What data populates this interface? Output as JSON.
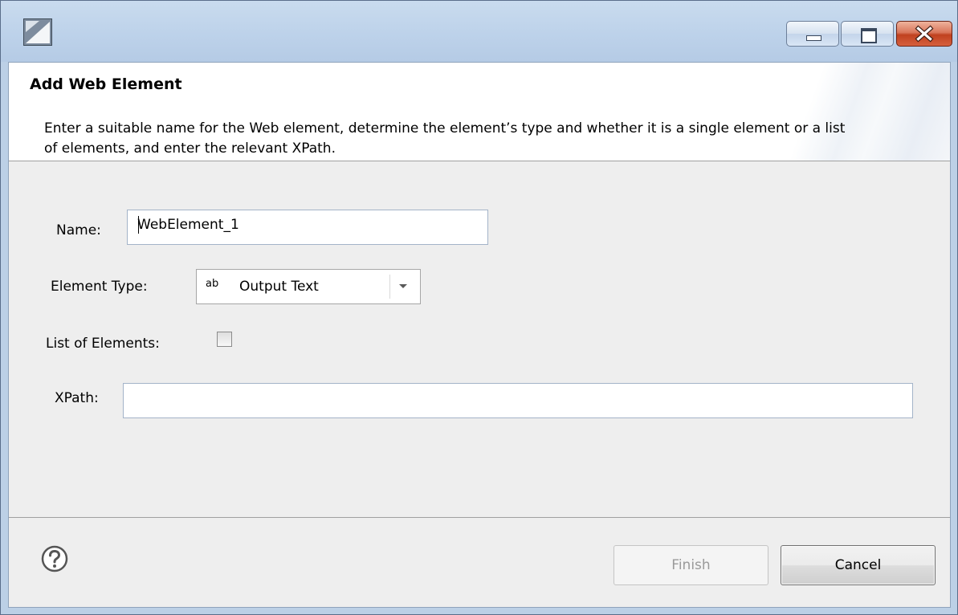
{
  "dialog": {
    "title": "Add Web Element",
    "description": "Enter a suitable name for the Web element, determine the element’s type and whether it is a single element or a list of elements, and enter the relevant XPath."
  },
  "form": {
    "name_label": "Name:",
    "name_value": "WebElement_1",
    "element_type_label": "Element Type:",
    "element_type_icon": "ab",
    "element_type_value": "Output Text",
    "list_label": "List of Elements:",
    "list_checked": false,
    "xpath_label": "XPath:",
    "xpath_value": ""
  },
  "buttons": {
    "finish_label": "Finish",
    "cancel_label": "Cancel"
  },
  "icons": {
    "app": "app-icon",
    "help": "help-icon",
    "minimize": "minimize-icon",
    "maximize": "maximize-icon",
    "close": "close-icon",
    "dropdown": "chevron-down-icon"
  },
  "colors": {
    "titlebar": "#bdd2ea",
    "close_button": "#c0411f",
    "dialog_background": "#eeeeee"
  }
}
